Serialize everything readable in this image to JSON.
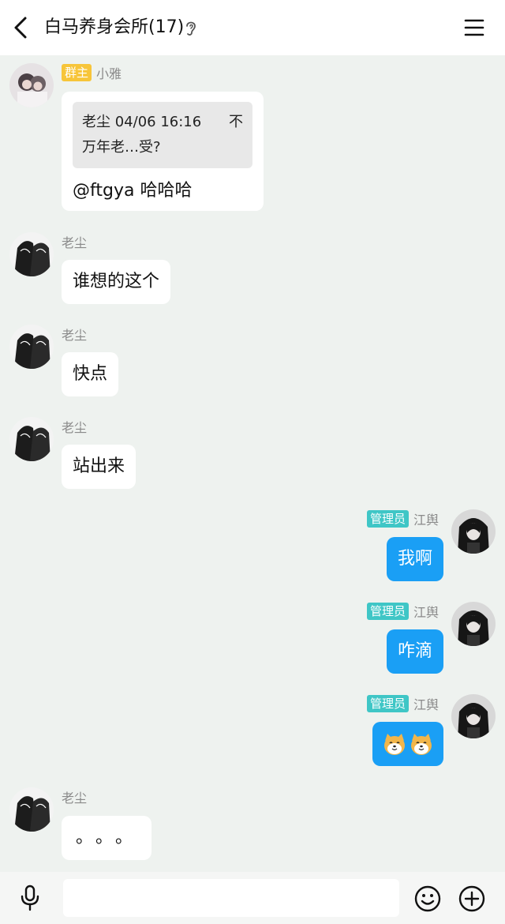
{
  "header": {
    "title": "白马养身会所(17)",
    "back_icon": "chevron-left-icon",
    "ear_icon": "ear-icon",
    "menu_icon": "hamburger-menu-icon"
  },
  "messages": [
    {
      "sender": "小雅",
      "badge": "群主",
      "direction": "in",
      "quote": {
        "author_time": "老尘 04/06 16:16",
        "action": "不",
        "text": "万年老…受?"
      },
      "text": "@ftgya 哈哈哈"
    },
    {
      "sender": "老尘",
      "direction": "in",
      "text": "谁想的这个"
    },
    {
      "sender": "老尘",
      "direction": "in",
      "text": "快点"
    },
    {
      "sender": "老尘",
      "direction": "in",
      "text": "站出来"
    },
    {
      "sender": "江舆",
      "badge": "管理员",
      "direction": "out",
      "text": "我啊"
    },
    {
      "sender": "江舆",
      "badge": "管理员",
      "direction": "out",
      "text": "咋滴"
    },
    {
      "sender": "江舆",
      "badge": "管理员",
      "direction": "out",
      "emoji": [
        "shiba-dog-face-icon",
        "shiba-dog-face-icon"
      ]
    },
    {
      "sender": "老尘",
      "direction": "in",
      "text": "。。。"
    }
  ],
  "bottom_bar": {
    "input_placeholder": "",
    "mic_icon": "microphone-icon",
    "emoji_icon": "smiley-icon",
    "plus_icon": "plus-circle-icon"
  },
  "colors": {
    "background": "#eef2ef",
    "outgoing_bubble": "#1a9ff5",
    "owner_badge": "#f7c53a",
    "admin_badge": "#3fc6c6"
  }
}
